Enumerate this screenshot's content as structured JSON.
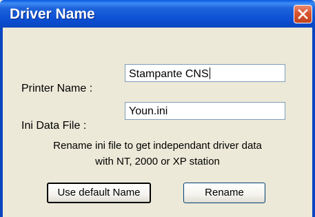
{
  "window": {
    "title": "Driver Name"
  },
  "form": {
    "printer_label": "Printer Name :",
    "printer_value": "Stampante CNS",
    "ini_label": "Ini Data File :",
    "ini_value": "Youn.ini"
  },
  "info": {
    "line1": "Rename ini file to get independant driver data",
    "line2": "with NT, 2000 or XP station"
  },
  "buttons": {
    "default_label": "Use default Name",
    "rename_label": "Rename"
  },
  "icons": {
    "close": "close-icon"
  }
}
